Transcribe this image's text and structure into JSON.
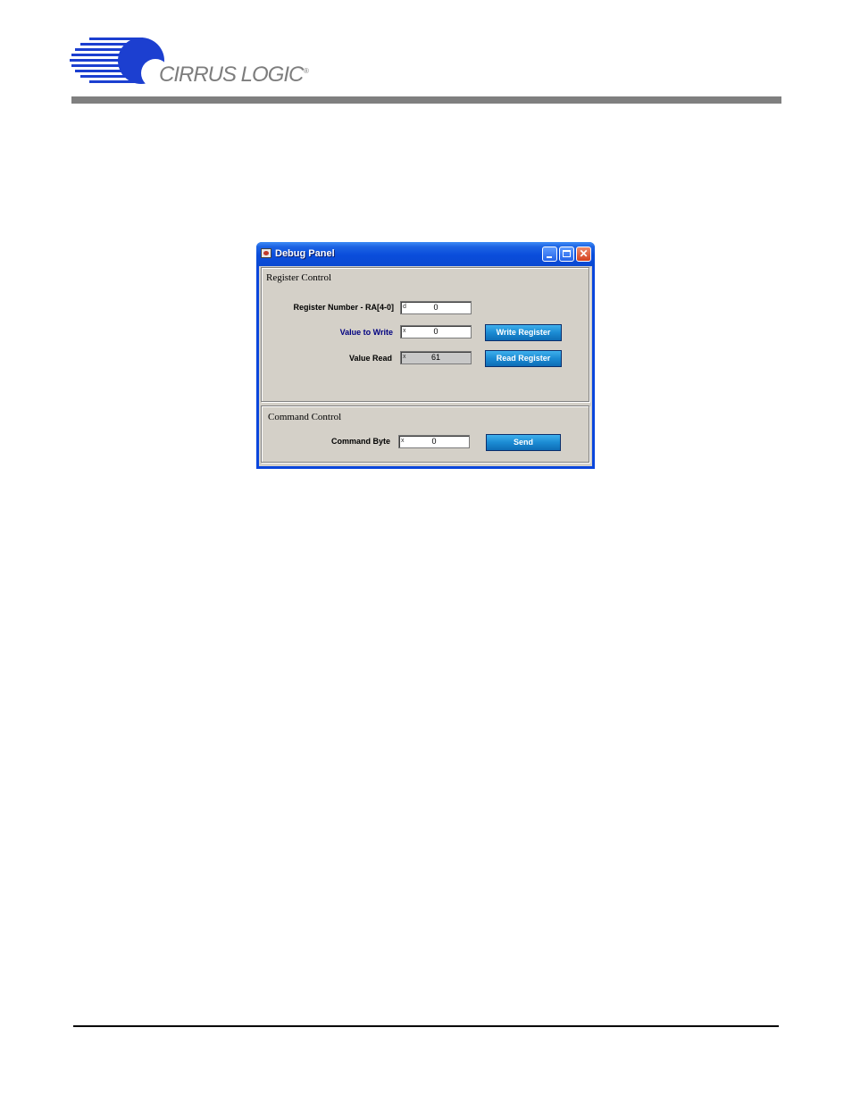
{
  "brand": {
    "name": "CIRRUS LOGIC",
    "trademark": "®",
    "logo_color": "#1c3fd0"
  },
  "window": {
    "title": "Debug Panel",
    "controls": [
      "minimize-icon",
      "maximize-icon",
      "close-icon"
    ],
    "close_symbol": "✕"
  },
  "register_control": {
    "title": "Register Control",
    "register_number": {
      "label": "Register Number - RA[4-0]",
      "prefix": "d",
      "value": "0"
    },
    "value_to_write": {
      "label": "Value to Write",
      "prefix": "x",
      "value": "0"
    },
    "value_read": {
      "label": "Value Read",
      "prefix": "x",
      "value": "61"
    },
    "write_button": "Write Register",
    "read_button": "Read Register"
  },
  "command_control": {
    "title": "Command Control",
    "command_byte": {
      "label": "Command Byte",
      "prefix": "x",
      "value": "0"
    },
    "send_button": "Send"
  },
  "colors": {
    "label_highlight": "#000080",
    "button_blue": "#1b8bd3"
  }
}
